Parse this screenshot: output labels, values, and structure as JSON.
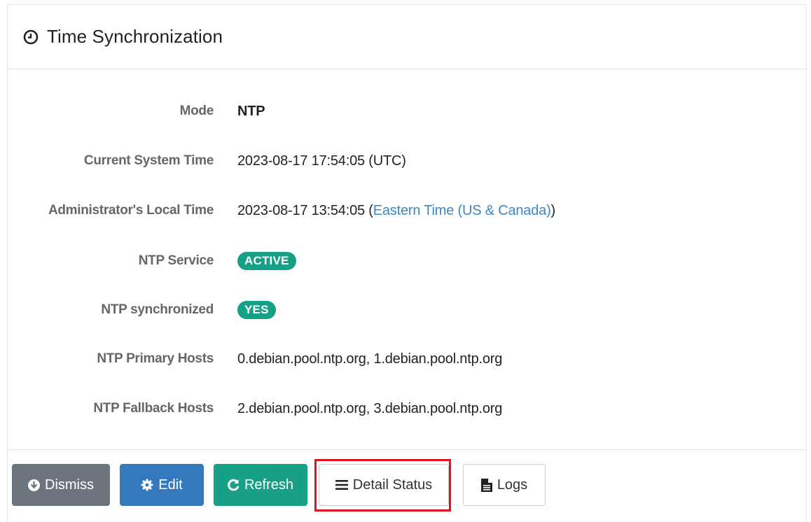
{
  "panel": {
    "title": "Time Synchronization",
    "title_icon": "clock-icon"
  },
  "fields": {
    "mode": {
      "label": "Mode",
      "value": "NTP"
    },
    "current_system_time": {
      "label": "Current System Time",
      "value": "2023-08-17 17:54:05 (UTC)"
    },
    "admin_local_time": {
      "label": "Administrator's Local Time",
      "value_prefix": "2023-08-17 13:54:05 (",
      "timezone_link": "Eastern Time (US & Canada)",
      "value_suffix": ")"
    },
    "ntp_service": {
      "label": "NTP Service",
      "badge": "ACTIVE"
    },
    "ntp_synchronized": {
      "label": "NTP synchronized",
      "badge": "YES"
    },
    "ntp_primary_hosts": {
      "label": "NTP Primary Hosts",
      "value": "0.debian.pool.ntp.org, 1.debian.pool.ntp.org"
    },
    "ntp_fallback_hosts": {
      "label": "NTP Fallback Hosts",
      "value": "2.debian.pool.ntp.org, 3.debian.pool.ntp.org"
    }
  },
  "buttons": {
    "dismiss": "Dismiss",
    "edit": "Edit",
    "refresh": "Refresh",
    "detail_status": "Detail Status",
    "logs": "Logs"
  },
  "colors": {
    "badge_green": "#17a085",
    "dismiss_gray": "#6c757d",
    "edit_blue": "#3478be",
    "link_blue": "#3c87c7",
    "highlight_red": "#e0141e"
  }
}
